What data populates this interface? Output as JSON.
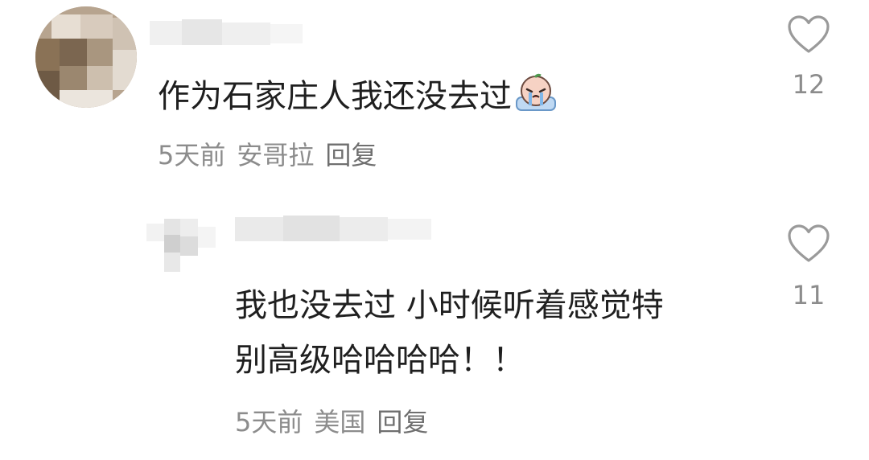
{
  "comments": [
    {
      "text": "作为石家庄人我还没去过",
      "emoji_icon": "crying-face-emoji-icon",
      "time": "5天前",
      "location": "安哥拉",
      "reply_label": "回复",
      "like_icon": "heart-outline-icon",
      "like_count": "12"
    },
    {
      "text_line1": "我也没去过 小时候听着感觉特",
      "text_line2": "别高级哈哈哈哈！！",
      "time": "5天前",
      "location": "美国",
      "reply_label": "回复",
      "like_icon": "heart-outline-icon",
      "like_count": "11"
    }
  ],
  "colors": {
    "text_primary": "#1f1f1f",
    "text_secondary": "#8c8c8c",
    "icon": "#9a9a9a",
    "background": "#ffffff"
  }
}
